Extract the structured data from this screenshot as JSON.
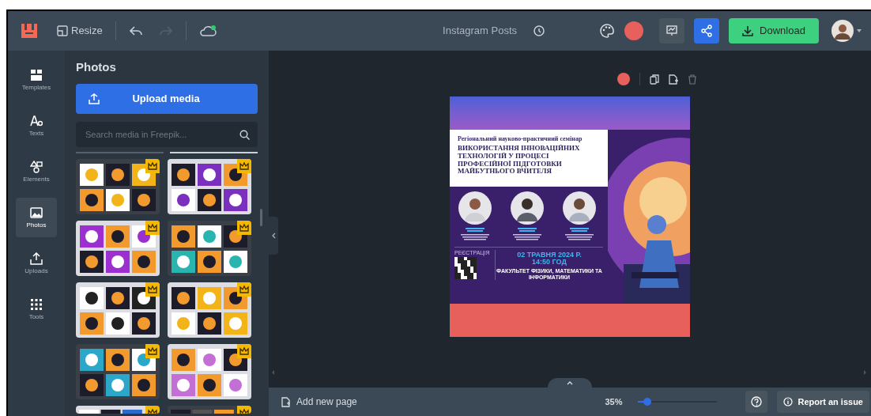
{
  "toolbar": {
    "resize": "Resize",
    "doc_title": "Instagram Posts",
    "download": "Download"
  },
  "rail": [
    {
      "kind": "templates",
      "label": "Templates",
      "selected": false
    },
    {
      "kind": "texts",
      "label": "Texts",
      "selected": false
    },
    {
      "kind": "elements",
      "label": "Elements",
      "selected": false
    },
    {
      "kind": "photos",
      "label": "Photos",
      "selected": true
    },
    {
      "kind": "uploads",
      "label": "Uploads",
      "selected": false
    },
    {
      "kind": "tools",
      "label": "Tools",
      "selected": false
    }
  ],
  "panel": {
    "title": "Photos",
    "upload": "Upload media",
    "search_placeholder": "Search media in Freepik...",
    "thumbnails": [
      {
        "premium": true
      },
      {
        "premium": true
      },
      {
        "premium": true
      },
      {
        "premium": true
      },
      {
        "premium": true
      },
      {
        "premium": true
      },
      {
        "premium": true
      },
      {
        "premium": true
      },
      {
        "premium": true
      },
      {
        "premium": true
      }
    ]
  },
  "canvas": {
    "poster": {
      "subtitle": "Регіональний науково-практичний семінар",
      "headline": "ВИКОРИСТАННЯ ІННОВАЦІЙНИХ ТЕХНОЛОГІЙ У ПРОЦЕСІ ПРОФЕСІЙНОЇ ПІДГОТОВКИ МАЙБУТНЬОГО ВЧИТЕЛЯ",
      "registration": "РЕЄСТРАЦІЯ",
      "date": "02 ТРАВНЯ 2024 Р.",
      "time": "14:50 ГОД",
      "faculty": "ФАКУЛЬТЕТ ФІЗИКИ, МАТЕМАТИКИ ТА ІНФОРМАТИКИ"
    }
  },
  "footer": {
    "add_page": "Add new page",
    "zoom": "35%",
    "level": 0.12,
    "report": "Report an issue"
  }
}
